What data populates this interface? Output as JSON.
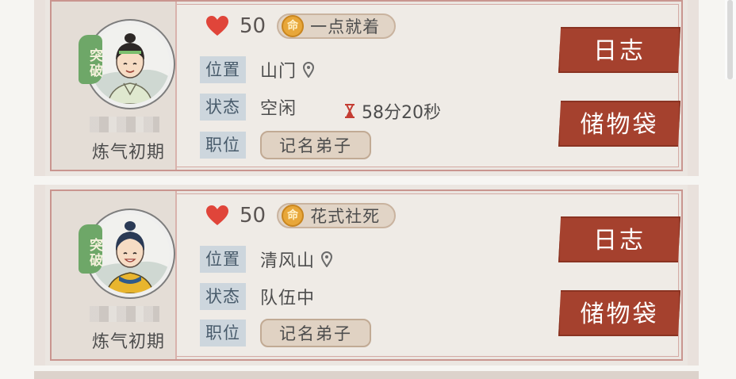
{
  "cards": [
    {
      "badge": "突破",
      "realm": "炼气初期",
      "hp": "50",
      "trait_icon": "命",
      "trait": "一点就着",
      "location_label": "位置",
      "location": "山门",
      "status_label": "状态",
      "status": "空闲",
      "timer": "58分20秒",
      "position_label": "职位",
      "position": "记名弟子",
      "log_button": "日志",
      "bag_button": "储物袋"
    },
    {
      "badge": "突破",
      "realm": "炼气初期",
      "hp": "50",
      "trait_icon": "命",
      "trait": "花式社死",
      "location_label": "位置",
      "location": "清风山",
      "status_label": "状态",
      "status": "队伍中",
      "timer": "",
      "position_label": "职位",
      "position": "记名弟子",
      "log_button": "日志",
      "bag_button": "储物袋"
    }
  ],
  "colors": {
    "button": "#a5412e",
    "tag_bg": "#cdd6dd",
    "heart": "#e0453a",
    "badge": "#6ea768"
  }
}
